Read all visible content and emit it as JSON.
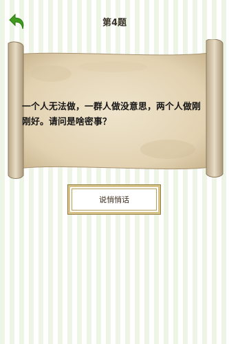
{
  "header": {
    "back_icon": "back-arrow-icon",
    "title": "第4题"
  },
  "question": {
    "text": "一个人无法做，一群人做没意思，两个人做刚刚好。请问是啥密事？"
  },
  "answer_button": {
    "label": "说悄悄话"
  },
  "colors": {
    "back_arrow": "#3f9a1f",
    "parchment": "#e3d4b6",
    "button_border": "#d7c48a"
  }
}
